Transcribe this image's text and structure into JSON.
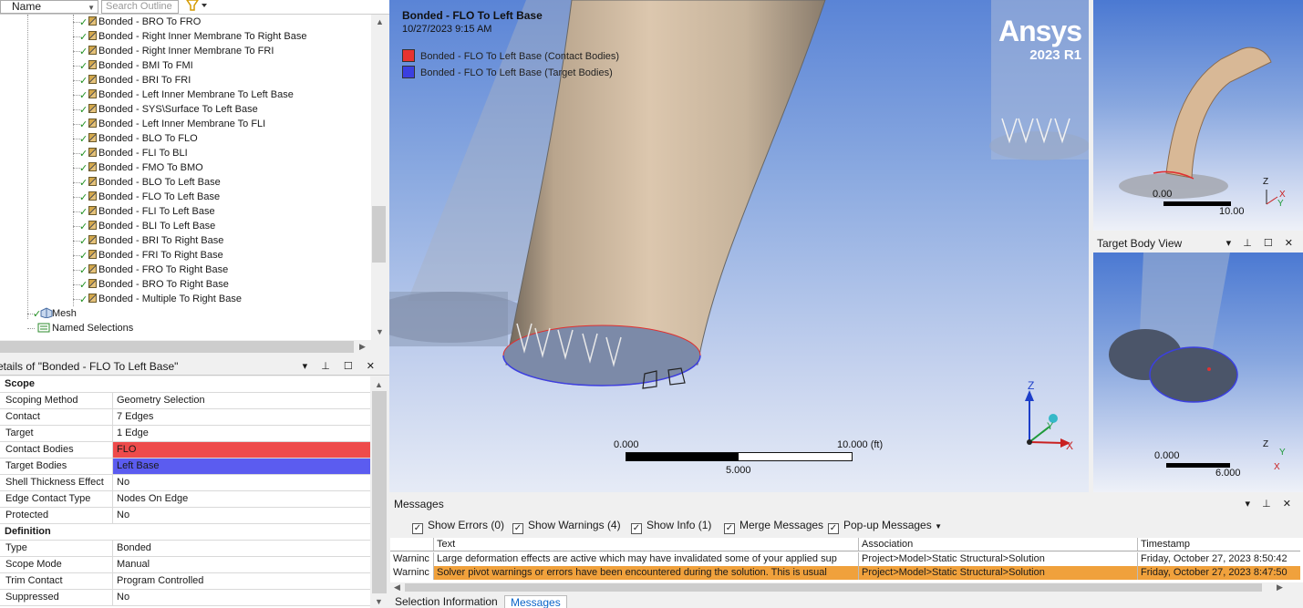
{
  "outline": {
    "name_column": "Name",
    "search_placeholder": "Search Outline",
    "contacts": [
      "Bonded - BRO To FRO",
      "Bonded - Right Inner Membrane To Right Base",
      "Bonded - Right Inner Membrane To FRI",
      "Bonded - BMI To FMI",
      "Bonded - BRI To FRI",
      "Bonded - Left Inner Membrane To Left Base",
      "Bonded - SYS\\Surface To Left Base",
      "Bonded - Left Inner Membrane To FLI",
      "Bonded - BLO To FLO",
      "Bonded - FLI To BLI",
      "Bonded - FMO To BMO",
      "Bonded - BLO To Left Base",
      "Bonded - FLO To Left Base",
      "Bonded - FLI To Left Base",
      "Bonded - BLI To Left Base",
      "Bonded - BRI To Right Base",
      "Bonded - FRI To Right Base",
      "Bonded - FRO To Right Base",
      "Bonded - BRO To Right Base",
      "Bonded - Multiple To Right Base"
    ],
    "mesh": "Mesh",
    "named_selections": "Named Selections"
  },
  "details": {
    "title": "etails of \"Bonded - FLO To Left Base\"",
    "rows": [
      {
        "k": "Scope",
        "v": "",
        "section": true
      },
      {
        "k": "Scoping Method",
        "v": "Geometry Selection"
      },
      {
        "k": "Contact",
        "v": "7 Edges"
      },
      {
        "k": "Target",
        "v": "1 Edge"
      },
      {
        "k": "Contact Bodies",
        "v": "FLO",
        "color": "#ee4b4b"
      },
      {
        "k": "Target Bodies",
        "v": "Left Base",
        "color": "#5b5cf0"
      },
      {
        "k": "Shell Thickness Effect",
        "v": "No"
      },
      {
        "k": "Edge Contact Type",
        "v": "Nodes On Edge"
      },
      {
        "k": "Protected",
        "v": "No"
      },
      {
        "k": "Definition",
        "v": "",
        "section": true
      },
      {
        "k": "Type",
        "v": "Bonded"
      },
      {
        "k": "Scope Mode",
        "v": "Manual"
      },
      {
        "k": "Trim Contact",
        "v": "Program Controlled"
      },
      {
        "k": "Suppressed",
        "v": "No"
      }
    ]
  },
  "viewport": {
    "title": "Bonded - FLO To Left Base",
    "date": "10/27/2023 9:15 AM",
    "legend": [
      {
        "label": "Bonded - FLO To Left Base (Contact Bodies)",
        "color": "#e8332f"
      },
      {
        "label": "Bonded - FLO To Left Base (Target Bodies)",
        "color": "#3b3fe0"
      }
    ],
    "brand": "Ansys",
    "version": "2023 R1",
    "scale": {
      "start": "0.000",
      "mid": "5.000",
      "end": "10.000 (ft)"
    },
    "axes": {
      "x": "X",
      "y": "Y",
      "z": "Z"
    }
  },
  "side_top": {
    "scale_start": "0.00",
    "scale_end": "10.00",
    "axes": {
      "x": "X",
      "y": "Y",
      "z": "Z"
    }
  },
  "side_bottom": {
    "title": "Target Body View",
    "scale_start": "0.000",
    "scale_end": "6.000",
    "axes": {
      "x": "X",
      "y": "Y",
      "z": "Z"
    }
  },
  "messages": {
    "title": "Messages",
    "filters": [
      {
        "label": "Show Errors",
        "count": "(0)"
      },
      {
        "label": "Show Warnings",
        "count": "(4)"
      },
      {
        "label": "Show Info",
        "count": "(1)"
      },
      {
        "label": "Merge Messages",
        "count": ""
      },
      {
        "label": "Pop-up Messages",
        "count": ""
      }
    ],
    "columns": [
      "Text",
      "Association",
      "Timestamp"
    ],
    "rows": [
      {
        "type": "Warninc",
        "text": "Large deformation effects are active which may have invalidated some of your applied sup",
        "assoc": "Project>Model>Static Structural>Solution",
        "time": "Friday, October 27, 2023 8:50:42"
      },
      {
        "type": "Warninc",
        "text": "Solver pivot warnings or errors have been encountered during the solution.  This is usual",
        "assoc": "Project>Model>Static Structural>Solution",
        "time": "Friday, October 27, 2023 8:47:50"
      }
    ],
    "tabs": [
      "Selection Information",
      "Messages"
    ]
  }
}
